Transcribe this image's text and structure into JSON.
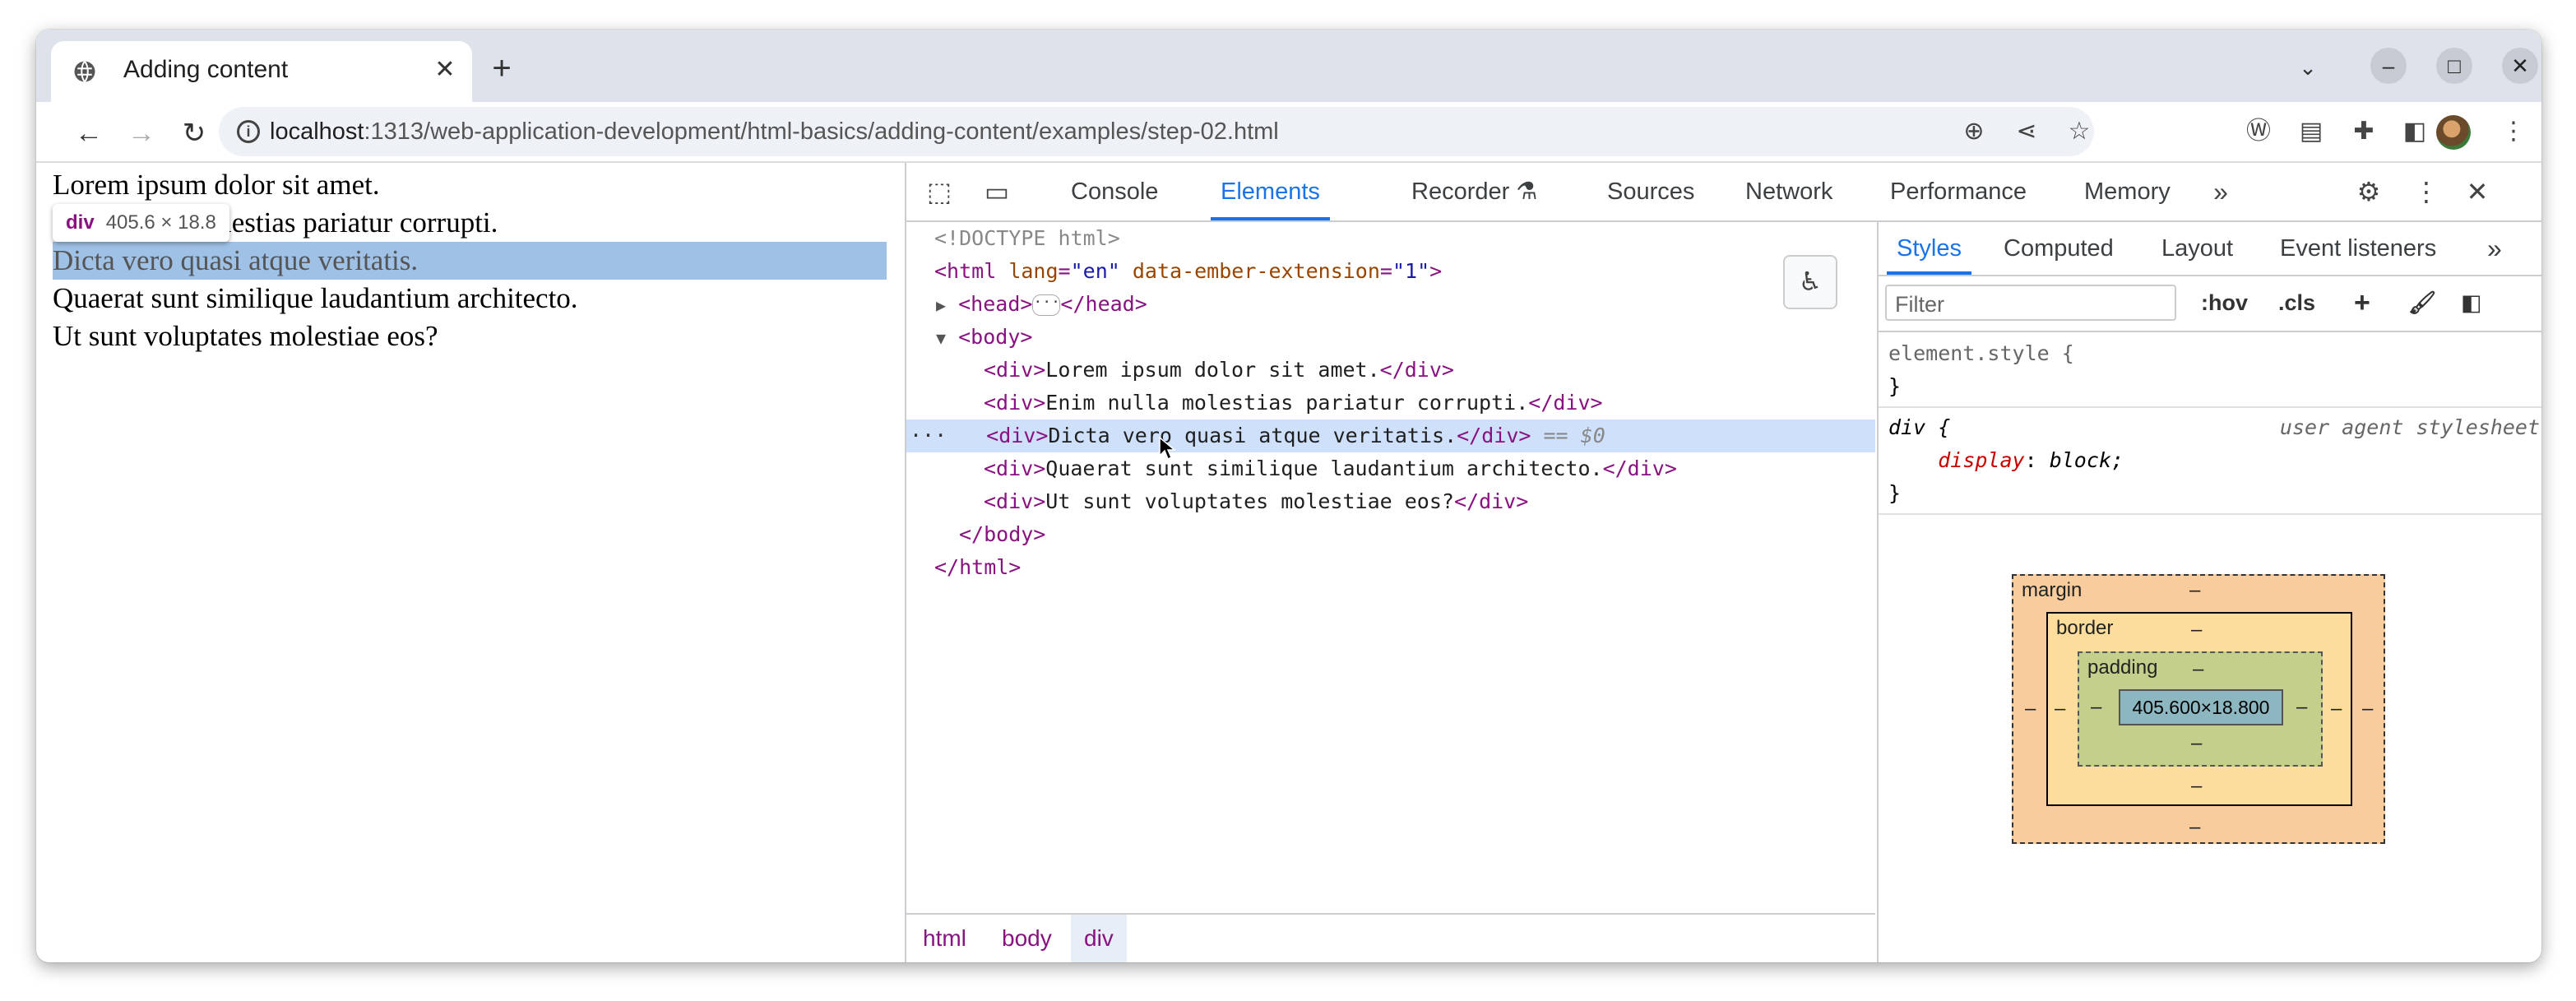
{
  "browser": {
    "tab_title": "Adding content",
    "url_host": "localhost",
    "url_path": ":1313/web-application-development/html-basics/adding-content/examples/step-02.html"
  },
  "page": {
    "lines": [
      "Lorem ipsum dolor sit amet.",
      "Enim nulla molestias pariatur corrupti.",
      "Dicta vero quasi atque veritatis.",
      "Quaerat sunt similique laudantium architecto.",
      "Ut sunt voluptates molestiae eos?"
    ],
    "tooltip_tag": "div",
    "tooltip_dims": "405.6 × 18.8"
  },
  "devtools": {
    "tabs": [
      "Console",
      "Elements",
      "Recorder",
      "Sources",
      "Network",
      "Performance",
      "Memory"
    ],
    "active_tab": "Elements",
    "dom": {
      "doctype": "<!DOCTYPE html>",
      "html_open_tag": "<html ",
      "html_attr1_name": "lang",
      "html_attr1_value": "\"en\"",
      "html_attr2_name": "data-ember-extension",
      "html_attr2_value": "\"1\"",
      "head_open": "<head>",
      "head_close": "</head>",
      "body_open": "<body>",
      "div_open": "<div>",
      "div_close": "</div>",
      "body_close": "</body>",
      "html_close": "</html>",
      "div_texts": [
        "Lorem ipsum dolor sit amet.",
        "Enim nulla molestias pariatur corrupti.",
        "Dicta vero quasi atque veritatis.",
        "Quaerat sunt similique laudantium architecto.",
        "Ut sunt voluptates molestiae eos?"
      ],
      "selected_marker": "== $0",
      "row_ellipsis": "···"
    },
    "breadcrumbs": [
      "html",
      "body",
      "div"
    ],
    "styles": {
      "tabs": [
        "Styles",
        "Computed",
        "Layout",
        "Event listeners"
      ],
      "active_tab": "Styles",
      "filter_placeholder": "Filter",
      "hov": ":hov",
      "cls": ".cls",
      "element_style": "element.style {",
      "close_brace": "}",
      "div_rule": "div {",
      "ua_label": "user agent stylesheet",
      "prop_name": "display",
      "prop_value": " block;",
      "box_model": {
        "margin_label": "margin",
        "border_label": "border",
        "padding_label": "padding",
        "content": "405.600×18.800",
        "dash": "–"
      }
    }
  }
}
